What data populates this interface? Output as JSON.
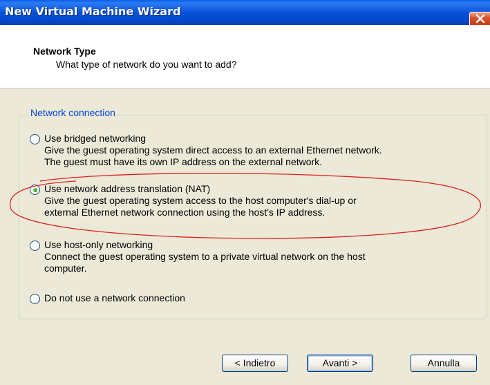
{
  "window": {
    "title": "New Virtual Machine Wizard",
    "close_icon": "close-icon"
  },
  "header": {
    "title": "Network Type",
    "subtitle": "What type of network do you want to add?"
  },
  "group": {
    "legend": "Network connection",
    "options": [
      {
        "label": "Use bridged networking",
        "selected": false,
        "description": [
          "Give the guest operating system direct access to an external Ethernet network.",
          "The guest must have its own IP address on the external network."
        ]
      },
      {
        "label": "Use network address translation (NAT)",
        "selected": true,
        "description": [
          "Give the guest operating system access to the host computer's dial-up or",
          "external Ethernet network connection using the host's IP address."
        ]
      },
      {
        "label": "Use host-only networking",
        "selected": false,
        "description": [
          "Connect the guest operating system to a private virtual network on the host",
          "computer."
        ]
      },
      {
        "label": "Do not use a network connection",
        "selected": false,
        "description": []
      }
    ]
  },
  "buttons": {
    "back": "< Indietro",
    "next": "Avanti >",
    "cancel": "Annulla"
  },
  "colors": {
    "titlebar": "#0852D8",
    "legend": "#0046D5",
    "annotation_ellipse": "#E0201C",
    "dialog_bg": "#ECE9D8"
  }
}
